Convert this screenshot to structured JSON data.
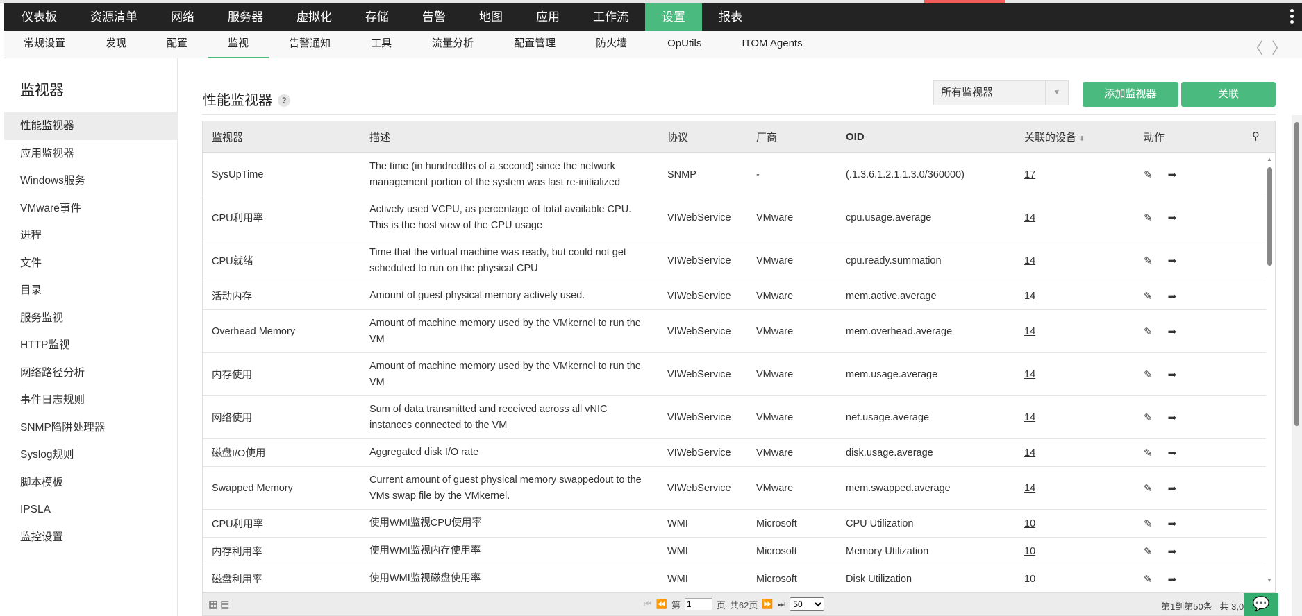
{
  "topnav": {
    "items": [
      "仪表板",
      "资源清单",
      "网络",
      "服务器",
      "虚拟化",
      "存储",
      "告警",
      "地图",
      "应用",
      "工作流",
      "设置",
      "报表"
    ],
    "active": 10
  },
  "subnav": {
    "items": [
      "常规设置",
      "发现",
      "配置",
      "监视",
      "告警通知",
      "工具",
      "流量分析",
      "配置管理",
      "防火墙",
      "OpUtils",
      "ITOM Agents"
    ],
    "active": 3
  },
  "sidebar": {
    "title": "监视器",
    "items": [
      "性能监视器",
      "应用监视器",
      "Windows服务",
      "VMware事件",
      "进程",
      "文件",
      "目录",
      "服务监视",
      "HTTP监视",
      "网络路径分析",
      "事件日志规则",
      "SNMP陷阱处理器",
      "Syslog规则",
      "脚本模板",
      "IPSLA",
      "监控设置"
    ]
  },
  "page": {
    "title": "性能监视器",
    "help": "?",
    "filter": "所有监视器",
    "add_button": "添加监视器",
    "associate_button": "关联"
  },
  "table": {
    "headers": [
      "监视器",
      "描述",
      "协议",
      "厂商",
      "OID",
      "关联的设备",
      "动作"
    ],
    "rows": [
      [
        "SysUpTime",
        "The time (in hundredths of a second) since the network management portion of the system was last re-initialized",
        "SNMP",
        "-",
        "(.1.3.6.1.2.1.1.3.0/360000)",
        "17"
      ],
      [
        "CPU利用率",
        "Actively used VCPU, as percentage of total available CPU. This is the host view of the CPU usage",
        "VIWebService",
        "VMware",
        "cpu.usage.average",
        "14"
      ],
      [
        "CPU就绪",
        "Time that the virtual machine was ready, but could not get scheduled to run on the physical CPU",
        "VIWebService",
        "VMware",
        "cpu.ready.summation",
        "14"
      ],
      [
        "活动内存",
        "Amount of guest physical memory actively used.",
        "VIWebService",
        "VMware",
        "mem.active.average",
        "14"
      ],
      [
        "Overhead Memory",
        "Amount of machine memory used by the VMkernel to run the VM",
        "VIWebService",
        "VMware",
        "mem.overhead.average",
        "14"
      ],
      [
        "内存使用",
        "Amount of machine memory used by the VMkernel to run the VM",
        "VIWebService",
        "VMware",
        "mem.usage.average",
        "14"
      ],
      [
        "网络使用",
        "Sum of data transmitted and received across all vNIC instances connected to the VM",
        "VIWebService",
        "VMware",
        "net.usage.average",
        "14"
      ],
      [
        "磁盘I/O使用",
        "Aggregated disk I/O rate",
        "VIWebService",
        "VMware",
        "disk.usage.average",
        "14"
      ],
      [
        "Swapped Memory",
        "Current amount of guest physical memory swappedout to the VMs swap file by the VMkernel.",
        "VIWebService",
        "VMware",
        "mem.swapped.average",
        "14"
      ],
      [
        "CPU利用率",
        "使用WMI监视CPU使用率",
        "WMI",
        "Microsoft",
        "CPU Utilization",
        "10"
      ],
      [
        "内存利用率",
        "使用WMI监视内存使用率",
        "WMI",
        "Microsoft",
        "Memory Utilization",
        "10"
      ],
      [
        "磁盘利用率",
        "使用WMI监视磁盘使用率",
        "WMI",
        "Microsoft",
        "Disk Utilization",
        "10"
      ]
    ],
    "two_line": [
      1,
      1,
      1,
      0,
      1,
      1,
      1,
      0,
      1,
      0,
      0,
      0
    ]
  },
  "pager": {
    "prefix": "第",
    "page": "1",
    "suffix": "页",
    "total": "共62页",
    "page_size": "50",
    "range": "第1到第50条",
    "count": "共 3,07"
  },
  "colors": {
    "accent": "#4aba7e",
    "nav": "#232323"
  }
}
